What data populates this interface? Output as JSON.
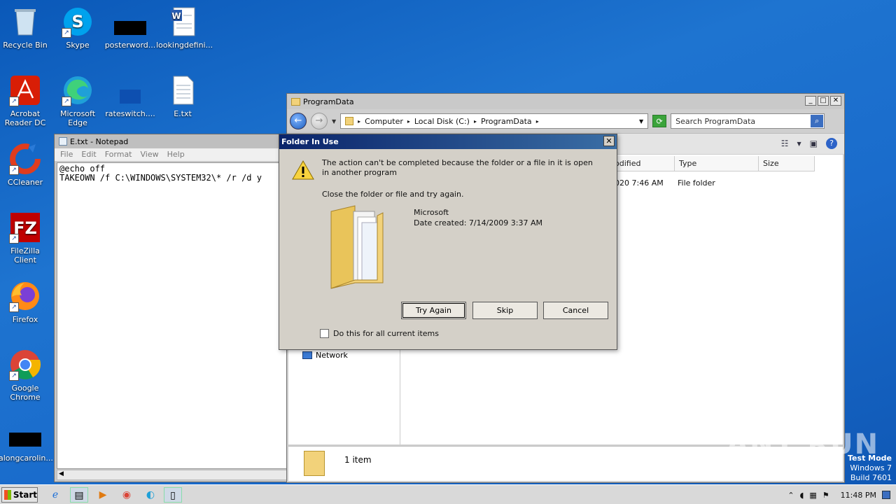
{
  "desktop": {
    "icons": [
      {
        "label": "Recycle Bin",
        "icon": "recycle-bin-icon"
      },
      {
        "label": "Skype",
        "icon": "skype-icon"
      },
      {
        "label": "posterword...",
        "icon": "file-icon"
      },
      {
        "label": "lookingdefini...",
        "icon": "word-doc-icon"
      },
      {
        "label": "Acrobat Reader DC",
        "icon": "acrobat-icon"
      },
      {
        "label": "Microsoft Edge",
        "icon": "edge-icon"
      },
      {
        "label": "rateswitch....",
        "icon": "file-icon"
      },
      {
        "label": "E.txt",
        "icon": "text-file-icon"
      },
      {
        "label": "CCleaner",
        "icon": "ccleaner-icon"
      },
      {
        "label": "FileZilla Client",
        "icon": "filezilla-icon"
      },
      {
        "label": "Firefox",
        "icon": "firefox-icon"
      },
      {
        "label": "Google Chrome",
        "icon": "chrome-icon"
      },
      {
        "label": "alongcarolin...",
        "icon": "file-icon"
      }
    ]
  },
  "notepad": {
    "title": "E.txt - Notepad",
    "menu": [
      "File",
      "Edit",
      "Format",
      "View",
      "Help"
    ],
    "content": "@echo off\nTAKEOWN /f C:\\WINDOWS\\SYSTEM32\\* /r /d y"
  },
  "explorer": {
    "title": "ProgramData",
    "breadcrumb": [
      "Computer",
      "Local Disk (C:)",
      "ProgramData"
    ],
    "search_placeholder": "Search ProgramData",
    "columns": [
      "odified",
      "Type",
      "Size"
    ],
    "row": {
      "modified": "020 7:46 AM",
      "type": "File folder"
    },
    "nav_network": "Network",
    "status": "1 item"
  },
  "dialog": {
    "title": "Folder In Use",
    "message": "The action can't be completed because the folder or a file in it is open in another program",
    "instruction": "Close the folder or file and try again.",
    "item_name": "Microsoft",
    "item_date": "Date created: 7/14/2009 3:37 AM",
    "buttons": {
      "try_again": "Try Again",
      "skip": "Skip",
      "cancel": "Cancel"
    },
    "checkbox_label": "Do this for all current items"
  },
  "taskbar": {
    "start_label": "Start",
    "clock": "11:48 PM"
  },
  "overlay": {
    "watermark": "ANY RUN",
    "test_mode_lines": [
      "Test Mode",
      "Windows 7",
      "Build 7601"
    ]
  }
}
